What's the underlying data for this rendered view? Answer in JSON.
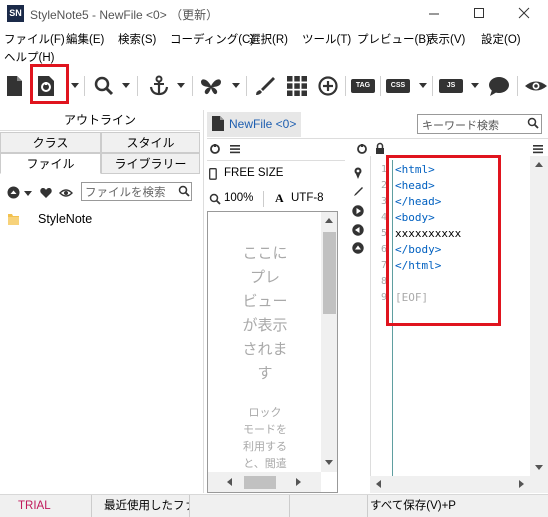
{
  "app": {
    "logo_text": "SN",
    "window_title": "StyleNote5 - NewFile <0>  （更新）"
  },
  "menu": [
    {
      "label": "ファイル(F)"
    },
    {
      "label": "編集(E)"
    },
    {
      "label": "検索(S)"
    },
    {
      "label": "コーディング(C)"
    },
    {
      "label": "選択(R)"
    },
    {
      "label": "ツール(T)"
    },
    {
      "label": "プレビュー(B)"
    },
    {
      "label": "表示(V)"
    },
    {
      "label": "設定(O)"
    },
    {
      "label": "ヘルプ(H)"
    }
  ],
  "toolbar": {
    "badges": {
      "tag": "TAG",
      "css": "CSS",
      "js": "JS"
    },
    "highlight_color": "#e0141e"
  },
  "left_panel": {
    "outline_label": "アウトライン",
    "tabs": {
      "class": "クラス",
      "style": "スタイル",
      "file": "ファイル",
      "library": "ライブラリー"
    },
    "file_search_placeholder": "ファイルを検索",
    "tree": [
      {
        "label": "StyleNote",
        "icon": "folder-icon"
      }
    ]
  },
  "middle_panel": {
    "file_tab_label": "NewFile <0>",
    "free_size_label": "FREE SIZE",
    "zoom_label": "100%",
    "encoding_label": "UTF-8",
    "preview_message": "ここにプレビューが表示されます",
    "preview_lines": [
      "ここに",
      "プレ",
      "ビュー",
      "が表示",
      "されま",
      "す"
    ],
    "preview_sub_lines": [
      "ロック",
      "モードを",
      "利用する",
      "と、閲遣"
    ]
  },
  "editor": {
    "keyword_placeholder": "キーワード検索",
    "lines": [
      {
        "num": "1",
        "text": "<html>",
        "kind": "tag"
      },
      {
        "num": "2",
        "text": "<head>",
        "kind": "tag"
      },
      {
        "num": "3",
        "text": "</head>",
        "kind": "tag"
      },
      {
        "num": "4",
        "text": "<body>",
        "kind": "tag"
      },
      {
        "num": "5",
        "text": "xxxxxxxxxx",
        "kind": "txt"
      },
      {
        "num": "6",
        "text": "</body>",
        "kind": "tag"
      },
      {
        "num": "7",
        "text": "</html>",
        "kind": "tag"
      },
      {
        "num": "8",
        "text": "",
        "kind": "txt"
      },
      {
        "num": "9",
        "text": "[EOF]",
        "kind": "eof"
      }
    ]
  },
  "statusbar": {
    "trial": "TRIAL",
    "recent": "最近使用したファ",
    "save_all": "すべて保存(V)+P"
  },
  "colors": {
    "trial": "#c0185a",
    "tag": "#0060c0",
    "accent_blue": "#1f5fb0",
    "highlight_red": "#e0141e"
  }
}
